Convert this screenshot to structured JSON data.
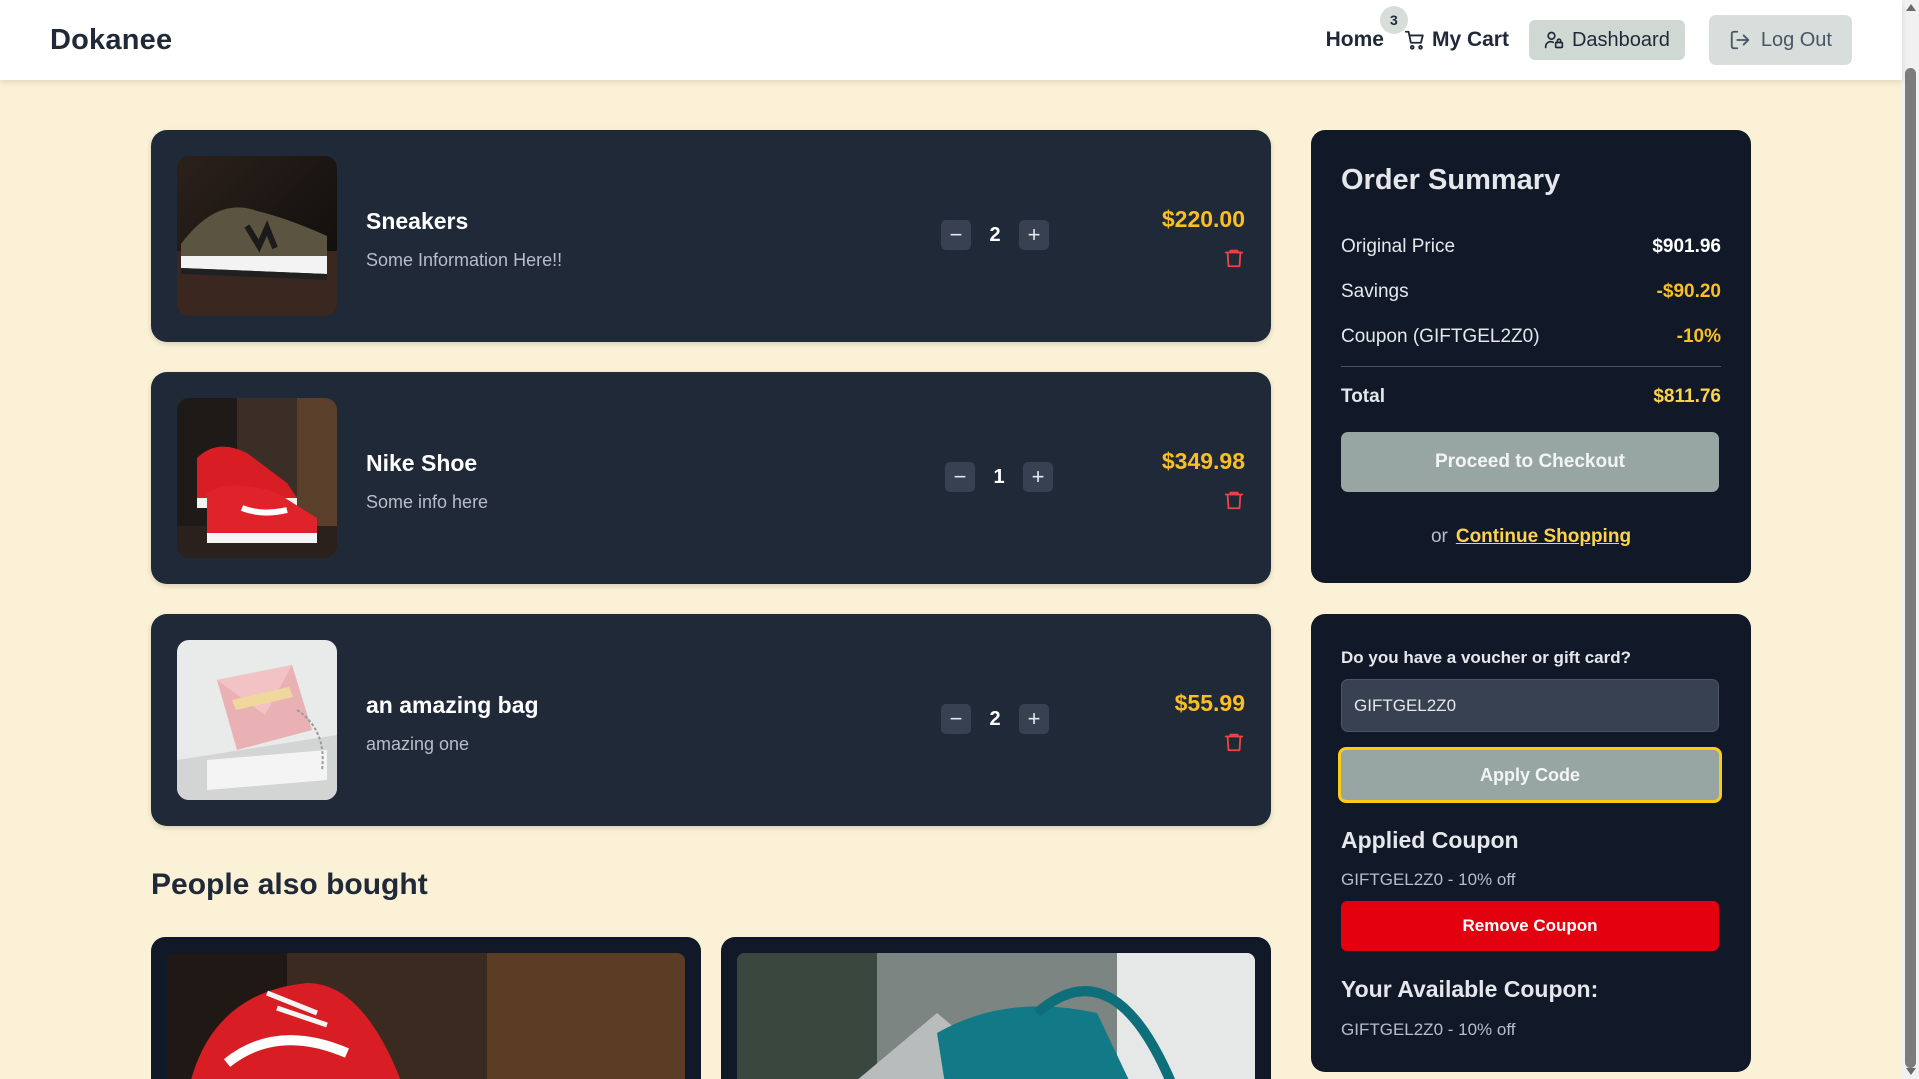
{
  "nav": {
    "brand": "Dokanee",
    "home": "Home",
    "cart": "My Cart",
    "cart_count": "3",
    "dashboard": "Dashboard",
    "logout": "Log Out"
  },
  "cart": {
    "items": [
      {
        "name": "Sneakers",
        "desc": "Some Information Here!!",
        "qty": "2",
        "price": "$220.00"
      },
      {
        "name": "Nike Shoe",
        "desc": "Some info here",
        "qty": "1",
        "price": "$349.98"
      },
      {
        "name": "an amazing bag",
        "desc": "amazing one",
        "qty": "2",
        "price": "$55.99"
      }
    ]
  },
  "recommendations": {
    "title": "People also bought"
  },
  "summary": {
    "title": "Order Summary",
    "rows": [
      {
        "label": "Original Price",
        "value": "$901.96"
      },
      {
        "label": "Savings",
        "value": "-$90.20"
      },
      {
        "label": "Coupon (GIFTGEL2Z0)",
        "value": "-10%"
      }
    ],
    "total_label": "Total",
    "total_value": "$811.76",
    "checkout": "Proceed to Checkout",
    "or": "or",
    "continue": "Continue Shopping"
  },
  "voucher": {
    "label": "Do you have a voucher or gift card?",
    "input_value": "GIFTGEL2Z0",
    "apply": "Apply Code",
    "applied_title": "Applied Coupon",
    "applied_text": "GIFTGEL2Z0 - 10% off",
    "remove": "Remove Coupon",
    "available_title": "Your Available Coupon:",
    "available_text": "GIFTGEL2Z0 - 10% off"
  },
  "colors": {
    "background": "#fbf1d6",
    "card": "#1f2937",
    "panel": "#111827",
    "price": "#fbbf24",
    "link": "#fcd34d",
    "danger": "#e3000f",
    "trash": "#ef4444"
  }
}
